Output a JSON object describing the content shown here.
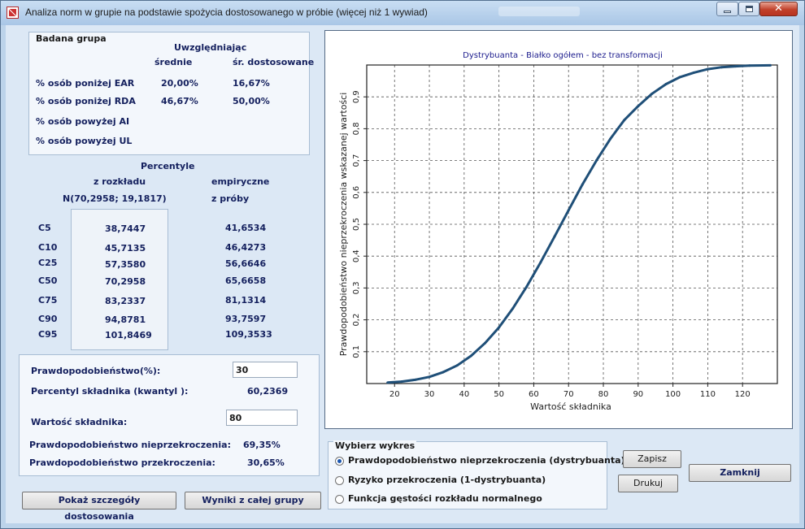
{
  "window": {
    "title": "Analiza norm w grupie na podstawie spożycia dostosowanego w próbie (więcej niż 1 wywiad)"
  },
  "group": {
    "title": "Badana grupa",
    "considering": "Uwzględniając",
    "col_mean": "średnie",
    "col_adjusted": "śr. dostosowane",
    "rows": [
      {
        "label": "% osób poniżej EAR",
        "mean": "20,00%",
        "adjusted": "16,67%"
      },
      {
        "label": "% osób poniżej RDA",
        "mean": "46,67%",
        "adjusted": "50,00%"
      },
      {
        "label": "% osób powyżej AI",
        "mean": "",
        "adjusted": ""
      },
      {
        "label": "% osób powyżej UL",
        "mean": "",
        "adjusted": ""
      }
    ]
  },
  "percentiles": {
    "title": "Percentyle",
    "col_dist_1": "z rozkładu",
    "col_dist_2": "N(70,2958;  19,1817)",
    "col_emp_1": "empiryczne",
    "col_emp_2": "z próby",
    "rows": [
      {
        "label": "C5",
        "dist": "38,7447",
        "emp": "41,6534"
      },
      {
        "label": "C10",
        "dist": "45,7135",
        "emp": "46,4273"
      },
      {
        "label": "C25",
        "dist": "57,3580",
        "emp": "56,6646"
      },
      {
        "label": "C50",
        "dist": "70,2958",
        "emp": "65,6658"
      },
      {
        "label": "C75",
        "dist": "83,2337",
        "emp": "81,1314"
      },
      {
        "label": "C90",
        "dist": "94,8781",
        "emp": "93,7597"
      },
      {
        "label": "C95",
        "dist": "101,8469",
        "emp": "109,3533"
      }
    ]
  },
  "calc": {
    "prob_label": "Prawdopodobieństwo(%):",
    "prob_value": "30",
    "quantile_label": "Percentyl składnika (kwantyl ):",
    "quantile_value": "60,2369",
    "value_label": "Wartość składnika:",
    "value_value": "80",
    "nonexceed_label": "Prawdopodobieństwo nieprzekroczenia:",
    "nonexceed_value": "69,35%",
    "exceed_label": "Prawdopodobieństwo przekroczenia:",
    "exceed_value": "30,65%"
  },
  "buttons": {
    "details": "Pokaż szczegóły dostosowania",
    "whole_group": "Wyniki z  całej grupy",
    "save": "Zapisz",
    "print": "Drukuj",
    "close": "Zamknij"
  },
  "chart_select": {
    "title": "Wybierz wykres",
    "options": [
      {
        "label": "Prawdopodobieństwo nieprzekroczenia (dystrybuanta)",
        "selected": true
      },
      {
        "label": "Ryzyko przekroczenia (1-dystrybuanta)",
        "selected": false
      },
      {
        "label": "Funkcja gęstości rozkładu normalnego",
        "selected": false
      }
    ]
  },
  "colors": {
    "curve": "#1f4f78",
    "title_text": "#1a1a8c",
    "label_text": "#14205e"
  },
  "chart_data": {
    "type": "line",
    "title": "Dystrybuanta - Białko ogółem - bez transformacji",
    "xlabel": "Wartość składnika",
    "ylabel": "Prawdopodobieństwo nieprzekroczenia wskazanej wartości",
    "xlim": [
      12,
      130
    ],
    "ylim": [
      0,
      1
    ],
    "xticks": [
      20,
      30,
      40,
      50,
      60,
      70,
      80,
      90,
      100,
      110,
      120
    ],
    "yticks": [
      0.1,
      0.2,
      0.3,
      0.4,
      0.5,
      0.6,
      0.7,
      0.8,
      0.9
    ],
    "ytick_labels": [
      "0,1",
      "0,2",
      "0,3",
      "0,4",
      "0,5",
      "0,6",
      "0,7",
      "0,8",
      "0,9"
    ],
    "grid": true,
    "series": [
      {
        "x": [
          18,
          22,
          26,
          30,
          34,
          38,
          42,
          46,
          50,
          54,
          58,
          62,
          66,
          70,
          74,
          78,
          82,
          86,
          90,
          94,
          98,
          102,
          106,
          110,
          114,
          118,
          122,
          128
        ],
        "values": [
          0.003,
          0.006,
          0.012,
          0.021,
          0.036,
          0.057,
          0.087,
          0.127,
          0.176,
          0.236,
          0.305,
          0.381,
          0.462,
          0.544,
          0.625,
          0.7,
          0.768,
          0.827,
          0.871,
          0.91,
          0.94,
          0.962,
          0.976,
          0.987,
          0.993,
          0.996,
          0.998,
          0.999
        ]
      }
    ]
  }
}
